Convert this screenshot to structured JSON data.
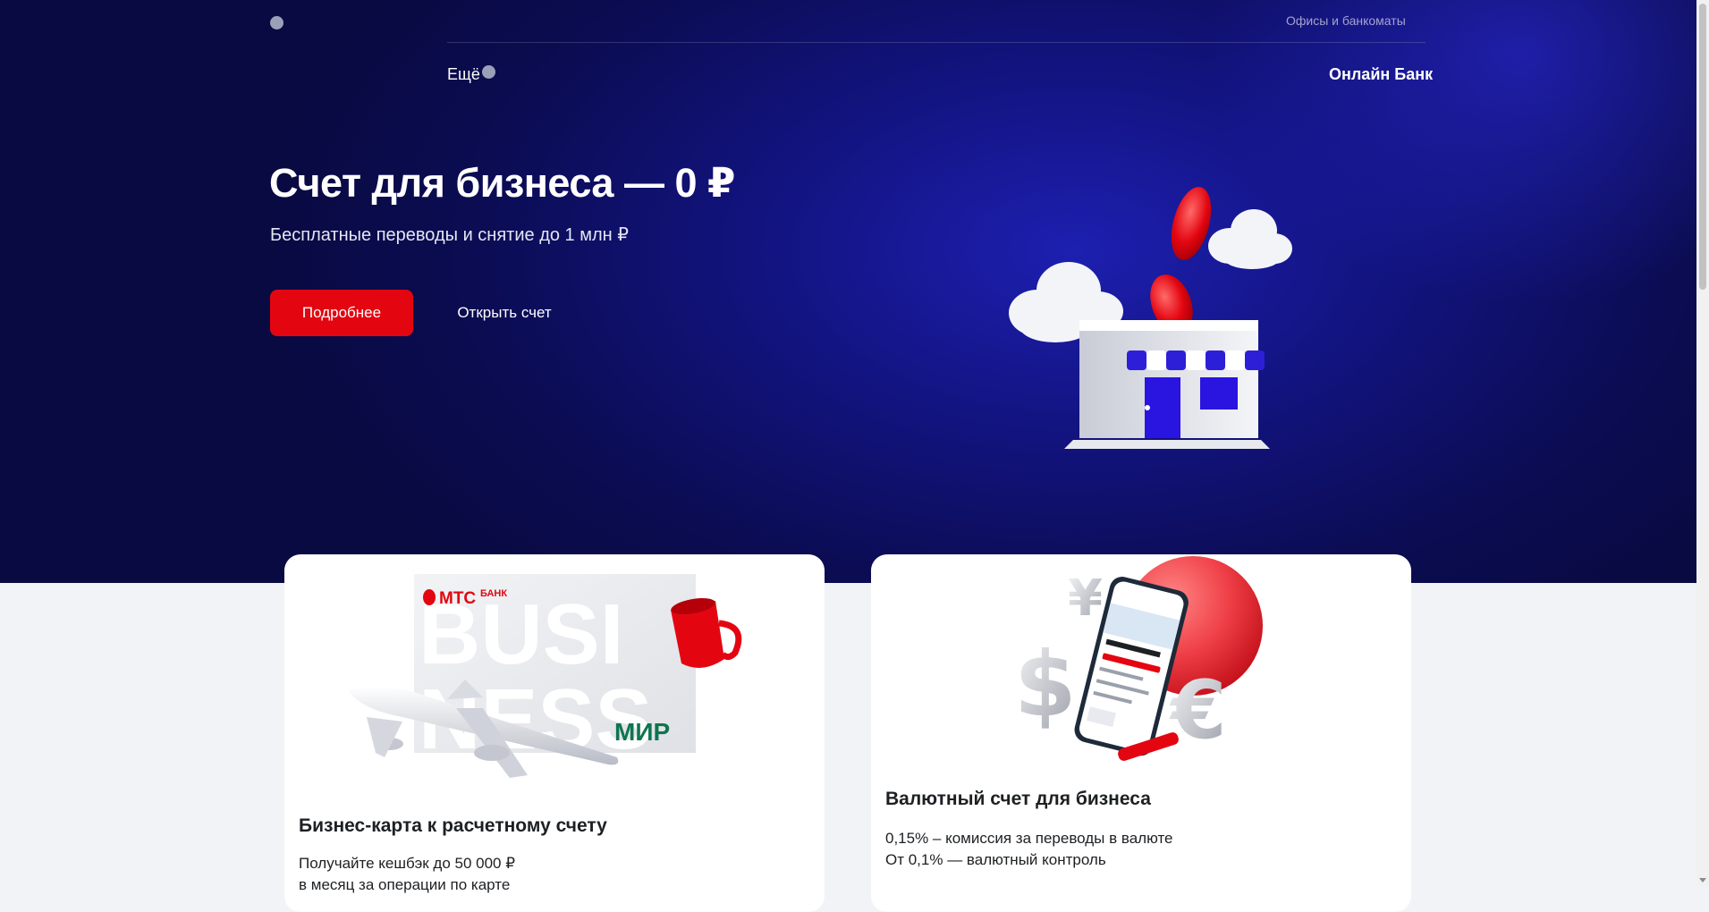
{
  "header": {
    "offices_link": "Офисы и банкоматы",
    "more_menu": "Ещё",
    "online_bank": "Онлайн Банк"
  },
  "hero": {
    "title": "Счет для бизнеса — 0 ₽",
    "subtitle": "Бесплатные переводы и снятие до 1 млн ₽",
    "primary_button": "Подробнее",
    "secondary_button": "Открыть счет"
  },
  "cards": [
    {
      "title": "Бизнес-карта к расчетному счету",
      "lines": [
        "Получайте кешбэк до 50 000 ₽",
        "в месяц за операции по карте"
      ],
      "image_text": {
        "brand": "МТС",
        "brand_suffix": "БАНК",
        "word_top": "BUSI",
        "word_bottom": "NESS",
        "payment_system": "МИР"
      }
    },
    {
      "title": "Валютный счет для бизнеса",
      "lines": [
        "0,15% – комиссия за переводы в валюте",
        "От 0,1% — валютный контроль"
      ]
    }
  ],
  "colors": {
    "accent_red": "#e30611",
    "hero_blue": "#12137e",
    "page_background": "#f2f3f7",
    "text_dark": "#1d2023"
  }
}
